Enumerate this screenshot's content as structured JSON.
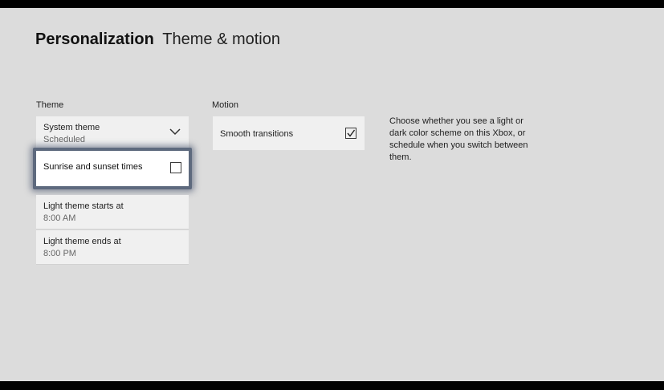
{
  "header": {
    "section": "Personalization",
    "page": "Theme & motion"
  },
  "theme": {
    "label": "Theme",
    "system_theme": {
      "title": "System theme",
      "value": "Scheduled"
    },
    "sunrise": {
      "label": "Sunrise and sunset times",
      "checked": false
    },
    "light_start": {
      "title": "Light theme starts at",
      "value": "8:00 AM"
    },
    "light_end": {
      "title": "Light theme ends at",
      "value": "8:00 PM"
    }
  },
  "motion": {
    "label": "Motion",
    "smooth": {
      "label": "Smooth transitions",
      "checked": true
    }
  },
  "description": "Choose whether you see a light or dark color scheme on this Xbox, or schedule when you switch between them.",
  "icons": {
    "dropdown": "chevron-down-icon",
    "checkbox": "checkbox-icon",
    "check": "checkmark-icon"
  }
}
